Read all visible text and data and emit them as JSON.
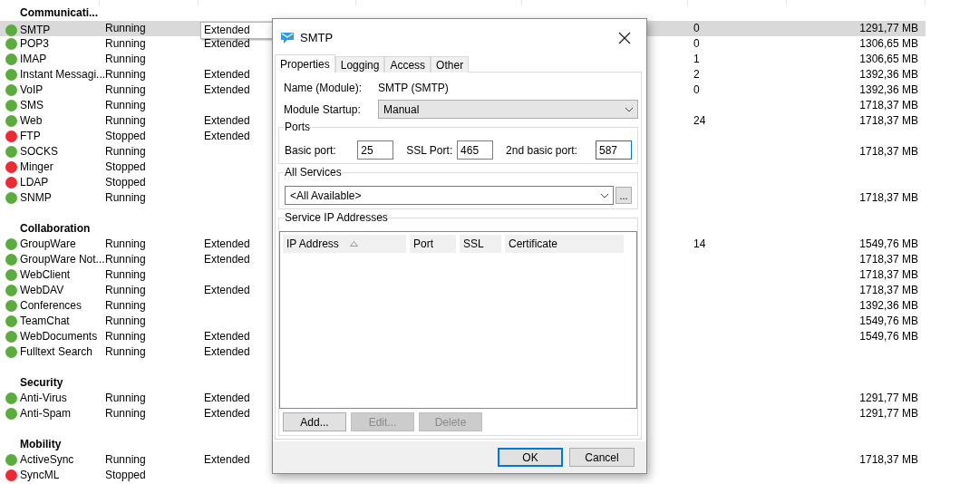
{
  "list": {
    "groups": [
      {
        "title": "Communicati...",
        "items": [
          {
            "name": "SMTP",
            "color": "#5aad3c",
            "status": "Running",
            "license": "Extended",
            "count": "0",
            "memory": "1291,77 MB",
            "selected": true
          },
          {
            "name": "POP3",
            "color": "#5aad3c",
            "status": "Running",
            "license": "Extended",
            "count": "0",
            "memory": "1306,65 MB",
            "selected": false
          },
          {
            "name": "IMAP",
            "color": "#5aad3c",
            "status": "Running",
            "count": "1",
            "memory": "1306,65 MB",
            "selected": false
          },
          {
            "name": "Instant Messagi...",
            "color": "#5aad3c",
            "status": "Running",
            "license": "Extended",
            "count": "2",
            "memory": "1392,36 MB",
            "selected": false
          },
          {
            "name": "VoIP",
            "color": "#5aad3c",
            "status": "Running",
            "license": "Extended",
            "count": "0",
            "memory": "1392,36 MB",
            "selected": false
          },
          {
            "name": "SMS",
            "color": "#5aad3c",
            "status": "Running",
            "memory": "1718,37 MB",
            "selected": false
          },
          {
            "name": "Web",
            "color": "#5aad3c",
            "status": "Running",
            "license": "Extended",
            "count": "24",
            "memory": "1718,37 MB",
            "selected": false
          },
          {
            "name": "FTP",
            "color": "#ec2a32",
            "status": "Stopped",
            "license": "Extended",
            "selected": false
          },
          {
            "name": "SOCKS",
            "color": "#5aad3c",
            "status": "Running",
            "memory": "1718,37 MB",
            "selected": false
          },
          {
            "name": "Minger",
            "color": "#ec2a32",
            "status": "Stopped",
            "selected": false
          },
          {
            "name": "LDAP",
            "color": "#ec2a32",
            "status": "Stopped",
            "selected": false
          },
          {
            "name": "SNMP",
            "color": "#5aad3c",
            "status": "Running",
            "memory": "1718,37 MB",
            "selected": false
          }
        ]
      },
      {
        "title": "Collaboration",
        "items": [
          {
            "name": "GroupWare",
            "color": "#5aad3c",
            "status": "Running",
            "license": "Extended",
            "count": "14",
            "memory": "1549,76 MB",
            "selected": false
          },
          {
            "name": "GroupWare Not...",
            "color": "#5aad3c",
            "status": "Running",
            "license": "Extended",
            "memory": "1718,37 MB",
            "selected": false
          },
          {
            "name": "WebClient",
            "color": "#5aad3c",
            "status": "Running",
            "memory": "1718,37 MB",
            "selected": false
          },
          {
            "name": "WebDAV",
            "color": "#5aad3c",
            "status": "Running",
            "license": "Extended",
            "memory": "1718,37 MB",
            "selected": false
          },
          {
            "name": "Conferences",
            "color": "#5aad3c",
            "status": "Running",
            "memory": "1392,36 MB",
            "selected": false
          },
          {
            "name": "TeamChat",
            "color": "#5aad3c",
            "status": "Running",
            "memory": "1549,76 MB",
            "selected": false
          },
          {
            "name": "WebDocuments",
            "color": "#5aad3c",
            "status": "Running",
            "license": "Extended",
            "memory": "1549,76 MB",
            "selected": false
          },
          {
            "name": "Fulltext Search",
            "color": "#5aad3c",
            "status": "Running",
            "license": "Extended",
            "selected": false
          }
        ]
      },
      {
        "title": "Security",
        "items": [
          {
            "name": "Anti-Virus",
            "color": "#5aad3c",
            "status": "Running",
            "license": "Extended",
            "memory": "1291,77 MB",
            "selected": false
          },
          {
            "name": "Anti-Spam",
            "color": "#5aad3c",
            "status": "Running",
            "license": "Extended",
            "memory": "1291,77 MB",
            "selected": false
          }
        ]
      },
      {
        "title": "Mobility",
        "items": [
          {
            "name": "ActiveSync",
            "color": "#5aad3c",
            "status": "Running",
            "license": "Extended",
            "memory": "1718,37 MB",
            "selected": false
          },
          {
            "name": "SyncML",
            "color": "#ec2a32",
            "status": "Stopped",
            "selected": false
          }
        ]
      }
    ]
  },
  "dialog": {
    "title": "SMTP",
    "tabs": [
      {
        "label": "Properties",
        "selected": true
      },
      {
        "label": "Logging",
        "selected": false
      },
      {
        "label": "Access",
        "selected": false
      },
      {
        "label": "Other",
        "selected": false
      }
    ],
    "name_label": "Name (Module):",
    "name_value": "SMTP (SMTP)",
    "startup_label": "Module Startup:",
    "startup_value": "Manual",
    "ports": {
      "title": "Ports",
      "fields": [
        {
          "label": "Basic port:",
          "value": "25",
          "focused": false
        },
        {
          "label": "SSL Port:",
          "value": "465",
          "focused": false
        },
        {
          "label": "2nd basic port:",
          "value": "587",
          "focused": true
        }
      ]
    },
    "services": {
      "title": "All Services",
      "value": "<All Available>",
      "more_button": "..."
    },
    "ip_addresses": {
      "title": "Service IP Addresses",
      "columns": [
        {
          "label": "IP Address",
          "sorted": true
        },
        {
          "label": "Port",
          "sorted": false
        },
        {
          "label": "SSL",
          "sorted": false
        },
        {
          "label": "Certificate",
          "sorted": false
        }
      ],
      "buttons": [
        {
          "label": "Add...",
          "disabled": false
        },
        {
          "label": "Edit...",
          "disabled": true
        },
        {
          "label": "Delete",
          "disabled": true
        }
      ]
    },
    "footer_buttons": [
      {
        "label": "OK",
        "default": true
      },
      {
        "label": "Cancel",
        "default": false
      }
    ]
  }
}
